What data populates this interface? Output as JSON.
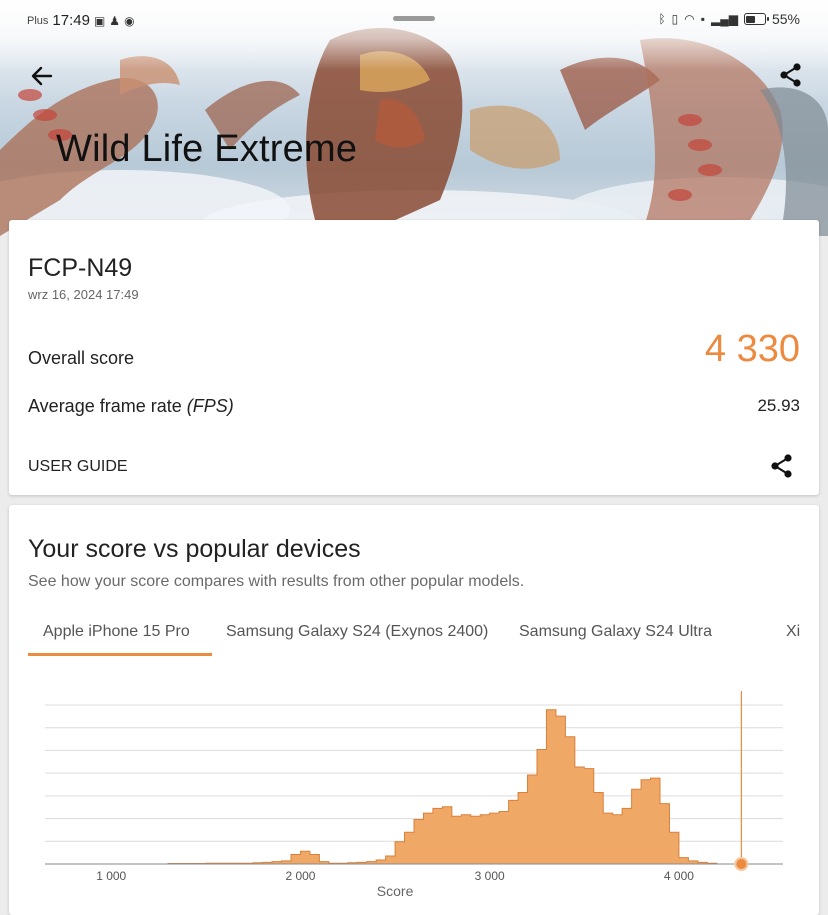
{
  "status_bar": {
    "carrier": "Plus",
    "time": "17:49",
    "battery": "55%"
  },
  "header": {
    "title": "Wild Life Extreme",
    "back_icon": "arrow-left-icon",
    "share_icon": "share-icon"
  },
  "result": {
    "device": "FCP-N49",
    "date": "wrz 16, 2024 17:49",
    "overall_label": "Overall score",
    "overall_value": "4 330",
    "fps_label_prefix": "Average frame rate ",
    "fps_label_unit": "(FPS)",
    "fps_value": "25.93",
    "user_guide": "USER GUIDE"
  },
  "comparison": {
    "title": "Your score vs popular devices",
    "subtitle": "See how your score compares with results from other popular models.",
    "tabs": [
      {
        "label": "Apple iPhone 15 Pro",
        "active": true
      },
      {
        "label": "Samsung Galaxy S24 (Exynos 2400)",
        "active": false
      },
      {
        "label": "Samsung Galaxy S24 Ultra",
        "active": false
      },
      {
        "label": "Xi",
        "active": false
      }
    ]
  },
  "colors": {
    "accent": "#ec8a3f",
    "area_fill": "#f0a866"
  },
  "chart_data": {
    "type": "area",
    "xlabel": "Score",
    "ylabel": "",
    "x_ticks": [
      "1 000",
      "2 000",
      "3 000",
      "4 000"
    ],
    "xlim": [
      650,
      4550
    ],
    "ylim": [
      0,
      100
    ],
    "grid": true,
    "your_score": 4330,
    "x": [
      650,
      1000,
      1300,
      1500,
      1750,
      1800,
      1850,
      1900,
      1950,
      2000,
      2050,
      2100,
      2150,
      2200,
      2250,
      2300,
      2350,
      2400,
      2450,
      2500,
      2550,
      2600,
      2650,
      2700,
      2750,
      2800,
      2850,
      2900,
      2950,
      3000,
      3050,
      3100,
      3150,
      3200,
      3250,
      3300,
      3350,
      3400,
      3450,
      3500,
      3550,
      3600,
      3650,
      3700,
      3750,
      3800,
      3850,
      3900,
      3950,
      4000,
      4050,
      4100,
      4150,
      4200,
      4250,
      4300,
      4350,
      4400
    ],
    "values": [
      0,
      0,
      0.3,
      0.5,
      0.8,
      1,
      1.5,
      2,
      6,
      8,
      6,
      1.5,
      0.5,
      0.5,
      0.8,
      1,
      1.5,
      2.5,
      5,
      14,
      20,
      28,
      32,
      35,
      36,
      30,
      31,
      30,
      31,
      32,
      33,
      40,
      45,
      56,
      72,
      97,
      93,
      80,
      61,
      60,
      45,
      32,
      31,
      35,
      47,
      53,
      54,
      38,
      20,
      4,
      2,
      1,
      0.5,
      0,
      0,
      0,
      0,
      0
    ]
  }
}
